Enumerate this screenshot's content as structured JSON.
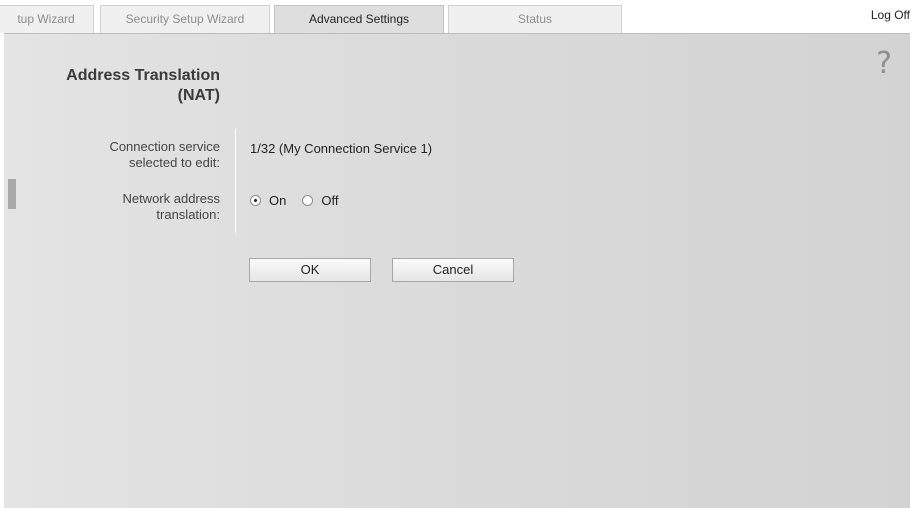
{
  "tabs": [
    {
      "label": "tup Wizard"
    },
    {
      "label": "Security Setup Wizard"
    },
    {
      "label": "Advanced Settings",
      "active": true
    },
    {
      "label": "Status"
    }
  ],
  "header": {
    "logoff": "Log Off"
  },
  "help": {
    "glyph": "?"
  },
  "page": {
    "title": "Address Translation (NAT)",
    "title_line1": "Address Translation",
    "title_line2": "(NAT)"
  },
  "form": {
    "connection_label_line1": "Connection service",
    "connection_label_line2": "selected to edit:",
    "connection_value": "1/32 (My Connection Service 1)",
    "nat_label_line1": "Network address",
    "nat_label_line2": "translation:",
    "nat_options": [
      {
        "label": "On",
        "selected": true
      },
      {
        "label": "Off",
        "selected": false
      }
    ]
  },
  "buttons": {
    "ok": "OK",
    "cancel": "Cancel"
  }
}
